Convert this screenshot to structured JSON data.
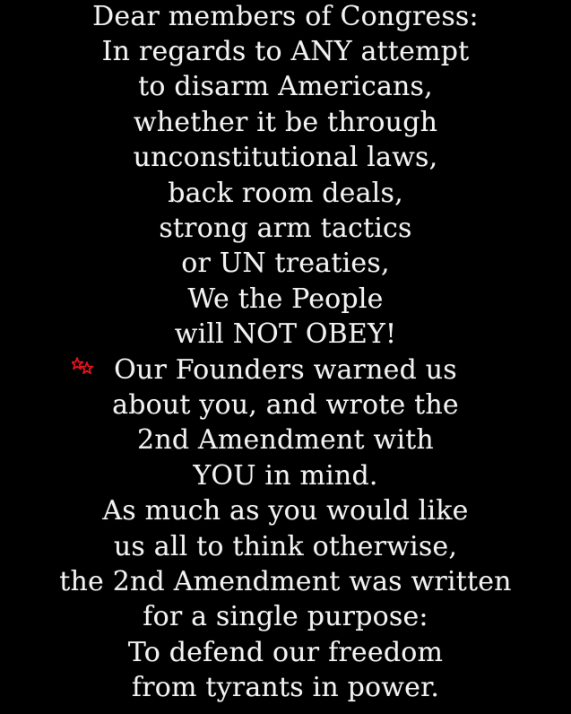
{
  "message": {
    "lines": [
      "Dear members of Congress:",
      "In regards to ANY attempt",
      "to disarm Americans,",
      "whether it be through",
      "unconstitutional laws,",
      "back room deals,",
      "strong arm tactics",
      "or UN treaties,",
      "We the People",
      "will NOT OBEY!",
      "Our Founders warned us",
      "about you, and wrote the",
      "2nd Amendment with",
      "YOU in mind.",
      "As much as you would like",
      "us all to think otherwise,",
      "the 2nd Amendment was written",
      "for a single purpose:",
      "To defend our freedom",
      "from tyrants in power."
    ]
  },
  "colors": {
    "background": "#000000",
    "text": "#f2f2f2",
    "star": "#e0141e"
  },
  "icons": {
    "star": "red-stars-icon"
  }
}
